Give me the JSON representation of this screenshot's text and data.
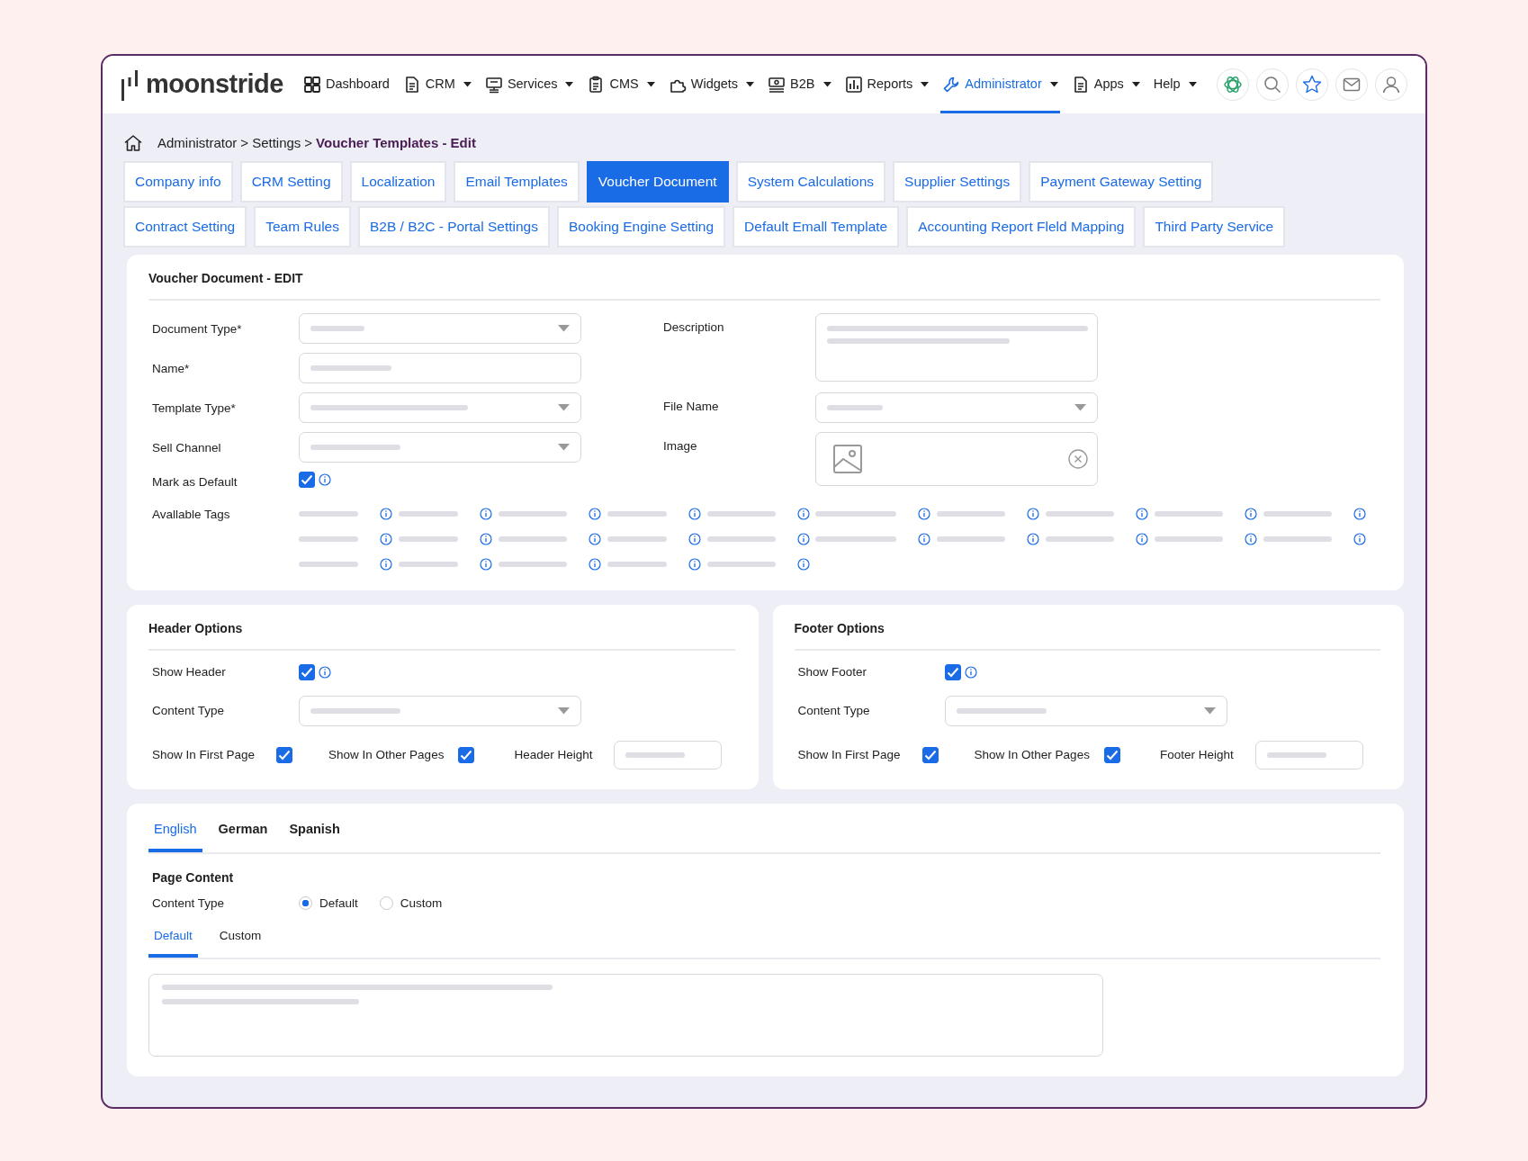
{
  "app": {
    "logo": "moonstride"
  },
  "nav": [
    {
      "label": "Dashboard",
      "dropdown": false,
      "selected": false
    },
    {
      "label": "CRM",
      "dropdown": true,
      "selected": false
    },
    {
      "label": "Services",
      "dropdown": true,
      "selected": false
    },
    {
      "label": "CMS",
      "dropdown": true,
      "selected": false
    },
    {
      "label": "Widgets",
      "dropdown": true,
      "selected": false
    },
    {
      "label": "B2B",
      "dropdown": true,
      "selected": false
    },
    {
      "label": "Reports",
      "dropdown": true,
      "selected": false
    },
    {
      "label": "Administrator",
      "dropdown": true,
      "selected": true
    },
    {
      "label": "Apps",
      "dropdown": true,
      "selected": false
    },
    {
      "label": "Help",
      "dropdown": true,
      "selected": false
    }
  ],
  "breadcrumb": [
    {
      "kind": "link",
      "label": "Administrator"
    },
    {
      "kind": "separator",
      "label": ">"
    },
    {
      "kind": "link",
      "label": "Settings"
    },
    {
      "kind": "separator",
      "label": ">"
    },
    {
      "kind": "current",
      "label": "Voucher Templates - Edit"
    }
  ],
  "settings_tabs": [
    {
      "tabs": [
        {
          "label": "Company info",
          "selected": false
        },
        {
          "label": "CRM Setting",
          "selected": false
        },
        {
          "label": "Localization",
          "selected": false
        },
        {
          "label": "Email Templates",
          "selected": false
        },
        {
          "label": "Voucher Document",
          "selected": true
        },
        {
          "label": "System Calculations",
          "selected": false
        },
        {
          "label": "Supplier Settings",
          "selected": false
        },
        {
          "label": "Payment Gateway Setting",
          "selected": false
        }
      ]
    },
    {
      "tabs": [
        {
          "label": "Contract Setting",
          "selected": false
        },
        {
          "label": "Team Rules",
          "selected": false
        },
        {
          "label": "B2B / B2C - Portal Settings",
          "selected": false
        },
        {
          "label": "Booking Engine Setting",
          "selected": false
        },
        {
          "label": "Default Emall Template",
          "selected": false
        },
        {
          "label": "Accounting Report Fleld Mapping",
          "selected": false
        },
        {
          "label": "Third Party Service",
          "selected": false
        }
      ]
    }
  ],
  "voucher": {
    "title": "Voucher Document - EDIT",
    "left_fields": [
      {
        "label": "Document Type*",
        "kind": "select"
      },
      {
        "label": "Name*",
        "kind": "input"
      },
      {
        "label": "Template Type*",
        "kind": "select"
      },
      {
        "label": "Sell Channel",
        "kind": "select"
      },
      {
        "label": "Mark as Default",
        "kind": "checkbox",
        "checked": true
      }
    ],
    "right_fields": [
      {
        "label": "Description",
        "kind": "textarea"
      },
      {
        "label": "File Name",
        "kind": "select"
      },
      {
        "label": "Image",
        "kind": "image"
      }
    ],
    "tags": {
      "label": "Avallable Tags"
    }
  },
  "options": [
    {
      "title": "Header Options",
      "show": {
        "label": "Show Header",
        "checked": true
      },
      "content_type": {
        "label": "Content Type"
      },
      "first_page": {
        "label": "Show In First Page",
        "checked": true
      },
      "other_pages": {
        "label": "Show In Other Pages",
        "checked": true
      },
      "height": {
        "label": "Header Height"
      }
    },
    {
      "title": "Footer Options",
      "show": {
        "label": "Show Footer",
        "checked": true
      },
      "content_type": {
        "label": "Content Type"
      },
      "first_page": {
        "label": "Show In First Page",
        "checked": true
      },
      "other_pages": {
        "label": "Show In Other Pages",
        "checked": true
      },
      "height": {
        "label": "Footer Height"
      }
    }
  ],
  "language_tabs": [
    {
      "label": "English",
      "selected": true
    },
    {
      "label": "German",
      "selected": false
    },
    {
      "label": "Spanish",
      "selected": false
    }
  ],
  "page_content": {
    "title": "Page Content",
    "content_type_label": "Content Type",
    "options": [
      {
        "label": "Default",
        "selected": true
      },
      {
        "label": "Custom",
        "selected": false
      }
    ],
    "subtabs": [
      {
        "label": "Default",
        "selected": true
      },
      {
        "label": "Custom",
        "selected": false
      }
    ]
  }
}
